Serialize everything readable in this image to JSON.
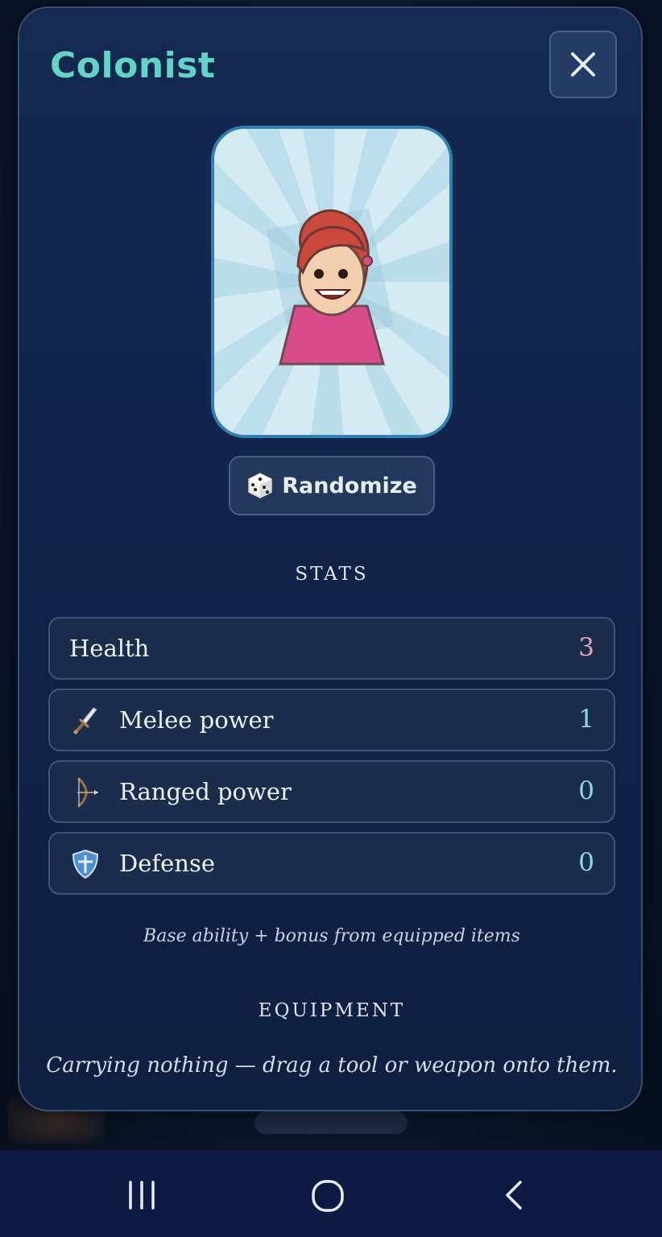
{
  "panel": {
    "title": "Colonist",
    "close_icon": "close-icon"
  },
  "portrait": {
    "icon": "colonist-avatar",
    "background_color": "#d4ebf3"
  },
  "randomize": {
    "label": "Randomize",
    "icon": "dice-icon"
  },
  "stats": {
    "heading": "STATS",
    "items": [
      {
        "label": "Health",
        "value": "3",
        "icon": "",
        "value_color": "#e8a4b4"
      },
      {
        "label": "Melee power",
        "value": "1",
        "icon": "sword-icon",
        "value_color": "#8ed8ec"
      },
      {
        "label": "Ranged power",
        "value": "0",
        "icon": "bow-icon",
        "value_color": "#8ed8ec"
      },
      {
        "label": "Defense",
        "value": "0",
        "icon": "shield-icon",
        "value_color": "#8ed8ec"
      }
    ],
    "note": "Base ability + bonus from equipped items"
  },
  "equipment": {
    "heading": "EQUIPMENT",
    "empty_text": "Carrying nothing — drag a tool or weapon onto them."
  },
  "colors": {
    "title": "#63d3c6",
    "panel_bg": "#12244a",
    "row_bg": "#1b2d4d",
    "accent_border": "#2f7fb0"
  },
  "navbar": {
    "recent_icon": "recent-apps-icon",
    "home_icon": "home-icon",
    "back_icon": "back-icon"
  }
}
